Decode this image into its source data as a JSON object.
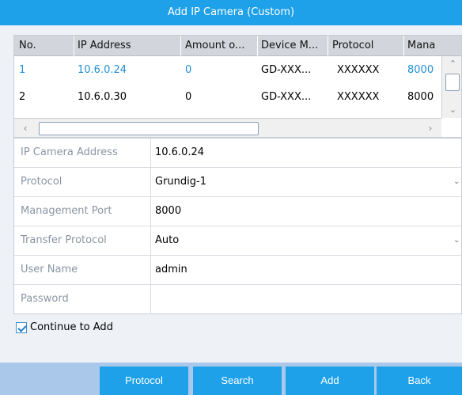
{
  "window": {
    "title": "Add IP Camera (Custom)"
  },
  "table": {
    "columns": [
      "No.",
      "IP Address",
      "Amount o...",
      "Device M...",
      "Protocol",
      "Mana"
    ],
    "rows": [
      {
        "no": "1",
        "ip": "10.6.0.24",
        "amount": "0",
        "model": "GD-XXX...",
        "protocol": "XXXXXX",
        "port": "8000"
      },
      {
        "no": "2",
        "ip": "10.6.0.30",
        "amount": "0",
        "model": "GD-XXX...",
        "protocol": "XXXXXX",
        "port": "8000"
      }
    ],
    "selected_row": 1
  },
  "form": {
    "ip_camera_address": {
      "label": "IP Camera Address",
      "value": "10.6.0.24"
    },
    "protocol": {
      "label": "Protocol",
      "value": "Grundig-1"
    },
    "management_port": {
      "label": "Management Port",
      "value": "8000"
    },
    "transfer_protocol": {
      "label": "Transfer Protocol",
      "value": "Auto"
    },
    "user_name": {
      "label": "User Name",
      "value": "admin"
    },
    "password": {
      "label": "Password",
      "value": ""
    }
  },
  "continue_to_add": {
    "label": "Continue to Add",
    "checked": true
  },
  "buttons": {
    "protocol": "Protocol",
    "search": "Search",
    "add": "Add",
    "back": "Back"
  },
  "colors": {
    "accent": "#1ea1e9",
    "bottom_bar": "#a9c8ea",
    "selected_text": "#1f8fd8"
  },
  "icons": {
    "scroll_up": "chevron-up-icon",
    "scroll_down": "chevron-down-icon",
    "scroll_left": "chevron-left-icon",
    "scroll_right": "chevron-right-icon",
    "dropdown": "chevron-down-icon",
    "checkbox": "check-icon"
  }
}
